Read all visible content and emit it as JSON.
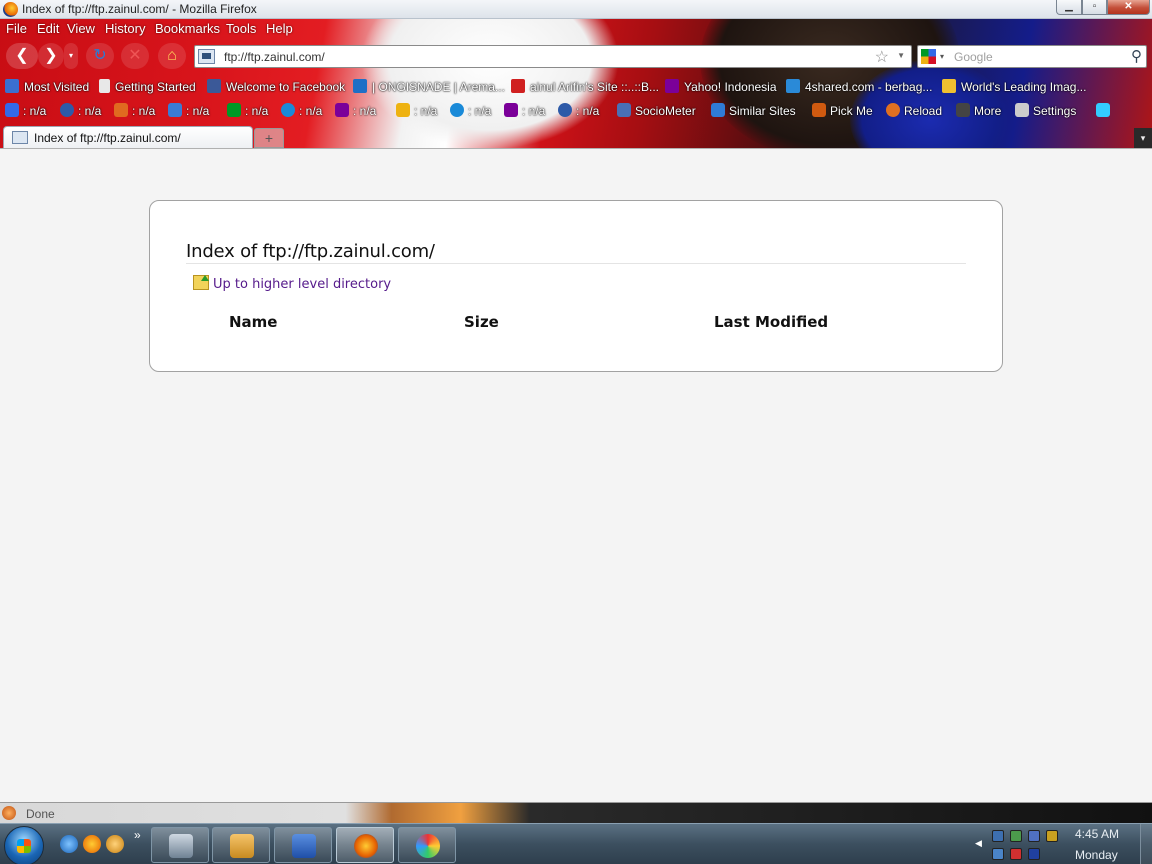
{
  "window": {
    "title": "Index of ftp://ftp.zainul.com/ - Mozilla Firefox"
  },
  "menu": [
    "File",
    "Edit",
    "View",
    "History",
    "Bookmarks",
    "Tools",
    "Help"
  ],
  "nav": {
    "url": "ftp://ftp.zainul.com/",
    "search_placeholder": "Google"
  },
  "bookmarks": [
    {
      "label": "Most Visited",
      "icon": "most-visited-icon",
      "color": "#3a6fd0"
    },
    {
      "label": "Getting Started",
      "icon": "page-icon",
      "color": "#e8e8e8"
    },
    {
      "label": "Welcome to Facebook",
      "icon": "facebook-icon",
      "color": "#3b5998"
    },
    {
      "label": "| ONGISNADE | Arema...",
      "icon": "ongisnade-icon",
      "color": "#1f6fc6"
    },
    {
      "label": "ainul Arifin's Site ::..::B...",
      "icon": "z-logo-icon",
      "color": "#d02020"
    },
    {
      "label": "Yahoo! Indonesia",
      "icon": "yahoo-icon",
      "color": "#7b0099"
    },
    {
      "label": "4shared.com - berbag...",
      "icon": "4shared-icon",
      "color": "#2a8ad8"
    },
    {
      "label": "World's Leading Imag...",
      "icon": "photobucket-icon",
      "color": "#f0c030"
    }
  ],
  "addons": [
    {
      "label": ": n/a",
      "icon": "google-rank-icon",
      "color": "#3369e8"
    },
    {
      "label": ": n/a",
      "icon": "alexa-icon",
      "color": "#2d5aa8"
    },
    {
      "label": ": n/a",
      "icon": "compete-icon",
      "color": "#e06a20"
    },
    {
      "label": ": n/a",
      "icon": "alexa-a-icon",
      "color": "#3a7bd5"
    },
    {
      "label": ": n/a",
      "icon": "google-index-icon",
      "color": "#009925"
    },
    {
      "label": ": n/a",
      "icon": "bing-icon",
      "color": "#1a8ad8"
    },
    {
      "label": ": n/a",
      "icon": "yahoo-y-icon",
      "color": "#7b0099"
    },
    {
      "label": ": n/a",
      "icon": "google-backlinks-icon",
      "color": "#eeb211"
    },
    {
      "label": ": n/a",
      "icon": "bing-backlinks-icon",
      "color": "#1a8ad8"
    },
    {
      "label": ": n/a",
      "icon": "yahoo-backlinks-icon",
      "color": "#7b0099"
    },
    {
      "label": ": n/a",
      "icon": "alexa-backlinks-icon",
      "color": "#2d5aa8"
    },
    {
      "label": "SocioMeter",
      "icon": "sociometer-icon",
      "color": "#4a6fb5"
    },
    {
      "label": "Similar Sites",
      "icon": "similar-sites-icon",
      "color": "#2f7bd6"
    },
    {
      "label": "Pick Me",
      "icon": "pickme-icon",
      "color": "#d05a10"
    },
    {
      "label": "Reload",
      "icon": "reload-icon",
      "color": "#e07020"
    },
    {
      "label": "More",
      "icon": "wr-icon",
      "color": "#444444"
    },
    {
      "label": "Settings",
      "icon": "settings-icon",
      "color": "#cccccc"
    },
    {
      "label": "",
      "icon": "twitter-icon",
      "color": "#33ccff"
    }
  ],
  "tabs": {
    "active_label": "Index of ftp://ftp.zainul.com/",
    "new_tab": "+",
    "list": "▾"
  },
  "page": {
    "heading": "Index of ftp://ftp.zainul.com/",
    "up_link": "Up to higher level directory",
    "columns": [
      "Name",
      "Size",
      "Last Modified"
    ]
  },
  "status": {
    "text": "Done"
  },
  "taskbar": {
    "time": "4:45 AM",
    "day": "Monday",
    "more": "»"
  }
}
